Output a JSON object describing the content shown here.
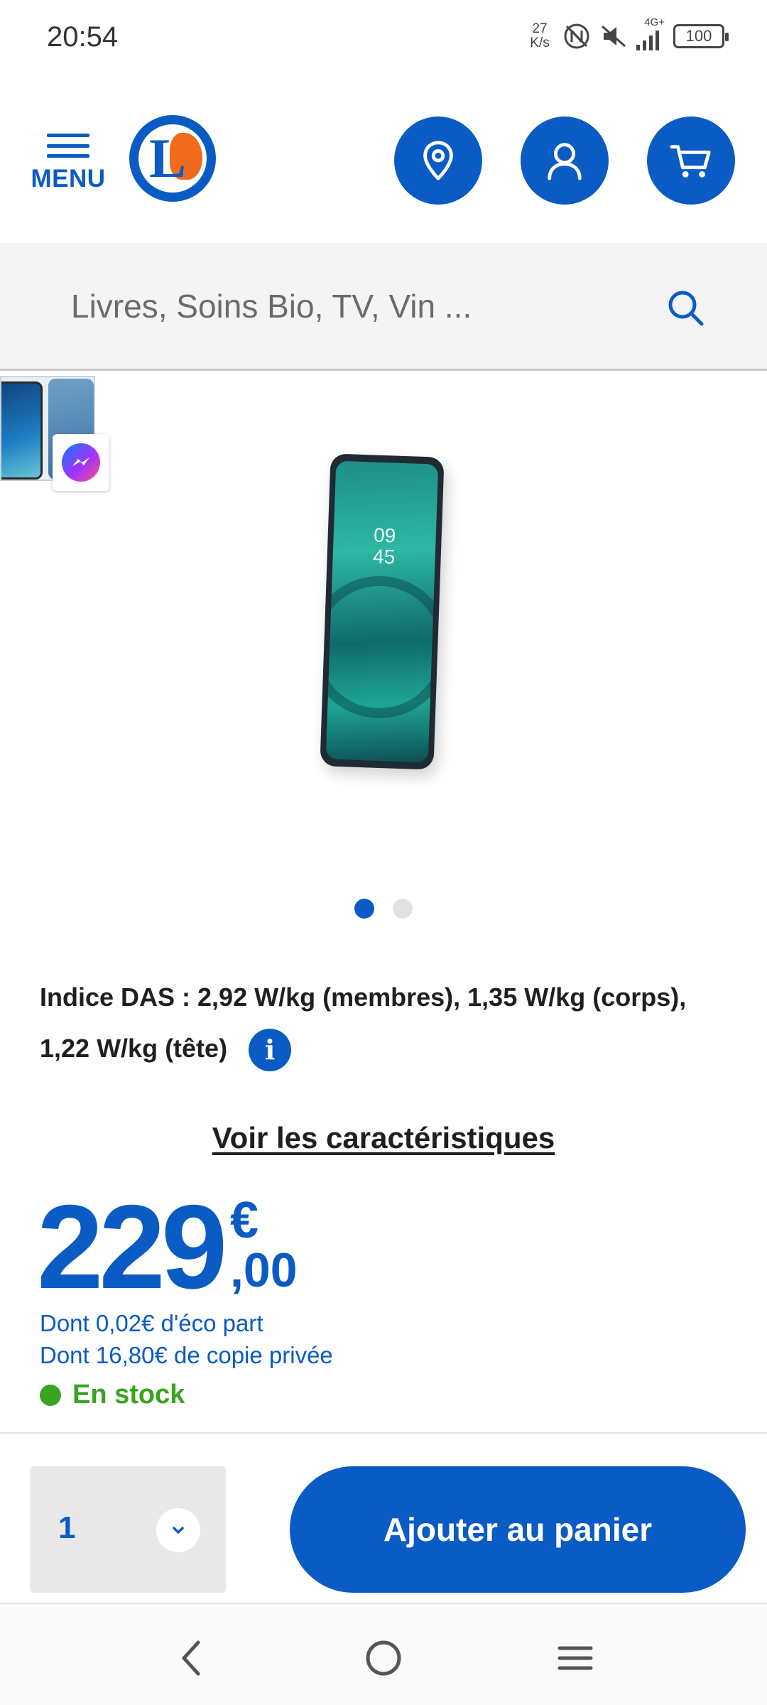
{
  "status_bar": {
    "time": "20:54",
    "speed_value": "27",
    "speed_unit": "K/s",
    "network": "4G+",
    "battery": "100",
    "icons": [
      "nfc-icon",
      "mute-icon",
      "signal-icon",
      "battery-icon"
    ]
  },
  "header": {
    "menu_label": "MENU",
    "logo_letter": "L",
    "buttons": [
      "location-pin-icon",
      "user-icon",
      "cart-icon"
    ]
  },
  "search": {
    "placeholder": "Livres, Soins Bio, TV, Vin ..."
  },
  "gallery": {
    "phone_clock_hour": "09",
    "phone_clock_min": "45",
    "slides_total": 2,
    "active_slide": 1
  },
  "product": {
    "das_text": "Indice DAS : 2,92 W/kg (membres), 1,35 W/kg (corps), 1,22 W/kg (tête)",
    "specs_link": "Voir les caractéristiques",
    "price_integer": "229",
    "price_currency": "€",
    "price_decimal": ",00",
    "eco_part": "Dont 0,02€ d'éco part",
    "private_copy": "Dont 16,80€ de copie privée",
    "stock_status": "En stock"
  },
  "purchase": {
    "quantity": "1",
    "add_to_cart_label": "Ajouter au panier"
  },
  "colors": {
    "brand_blue": "#0a5bc4",
    "brand_orange": "#f26a1b",
    "stock_green": "#3aa320"
  }
}
